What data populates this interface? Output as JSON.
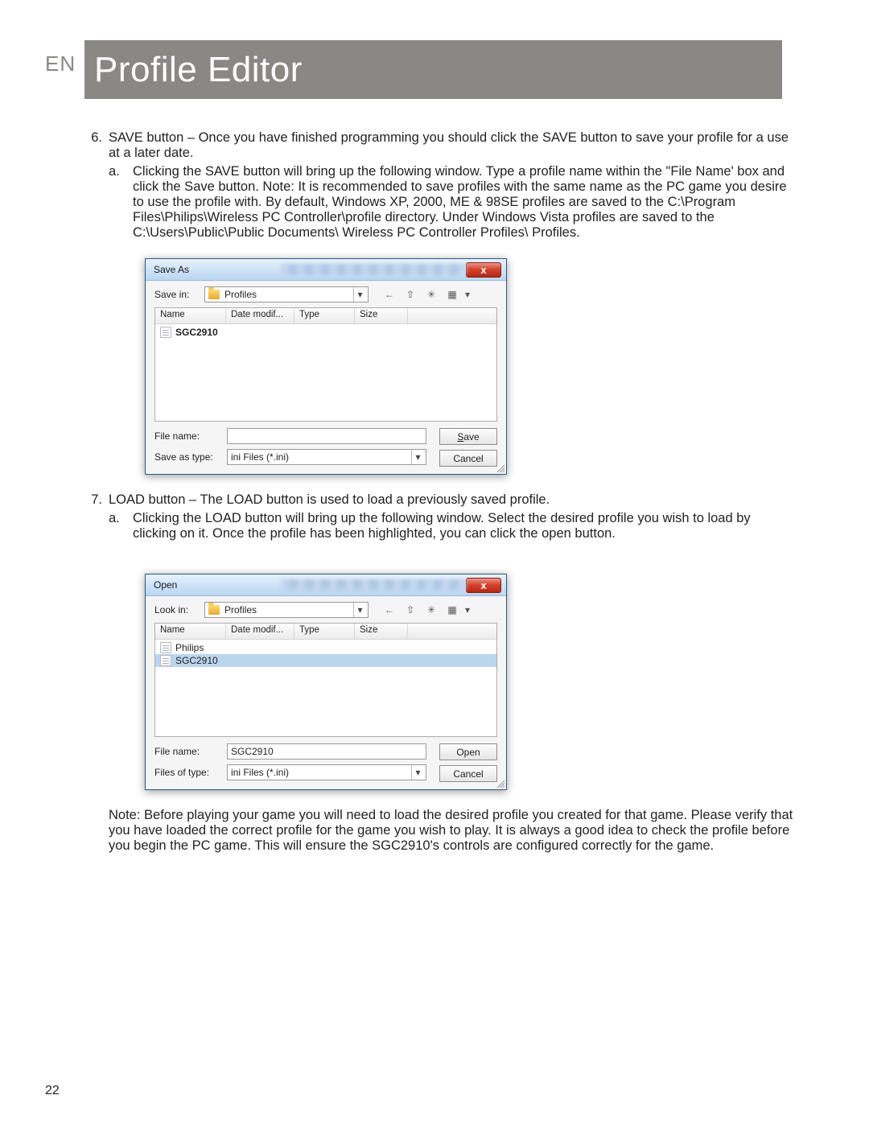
{
  "header": {
    "lang": "EN",
    "title": "Profile Editor"
  },
  "step6": {
    "num": "6.",
    "text": "SAVE button – Once you have finished programming you should click the SAVE button to save your profile for a use at a later date.",
    "sub_a_label": "a.",
    "sub_a_text": "Clicking the SAVE button will bring up the following window. Type a profile name within the \"File Name' box and click the Save button. Note: It is recommended to save profiles with the same name as the PC game you desire to use the profile with. By default, Windows XP, 2000, ME & 98SE profiles are saved to the C:\\Program Files\\Philips\\Wireless PC Controller\\profile directory. Under Windows Vista profiles are saved to the C:\\Users\\Public\\Public Documents\\ Wireless PC Controller Profiles\\ Profiles."
  },
  "saveDialog": {
    "title": "Save As",
    "close": "x",
    "saveInLabel": "Save in:",
    "folder": "Profiles",
    "columns": {
      "name": "Name",
      "date": "Date modif...",
      "type": "Type",
      "size": "Size"
    },
    "files": [
      {
        "name": "SGC2910",
        "selected": false
      }
    ],
    "fileNameLabel": "File name:",
    "fileNameValue": "",
    "saveTypeLabel": "Save as type:",
    "saveTypeValue": "ini Files (*.ini)",
    "btnSave": "Save",
    "btnCancel": "Cancel"
  },
  "step7": {
    "num": "7.",
    "text": "LOAD button – The LOAD button is used to load a previously saved profile.",
    "sub_a_label": "a.",
    "sub_a_text": "Clicking the LOAD button will bring up the following window. Select the desired profile you wish to load by clicking on it. Once the profile has been highlighted, you can click the open button."
  },
  "openDialog": {
    "title": "Open",
    "close": "x",
    "lookInLabel": "Look in:",
    "folder": "Profiles",
    "columns": {
      "name": "Name",
      "date": "Date modif...",
      "type": "Type",
      "size": "Size"
    },
    "files": [
      {
        "name": "Philips",
        "selected": false
      },
      {
        "name": "SGC2910",
        "selected": true
      }
    ],
    "fileNameLabel": "File name:",
    "fileNameValue": "SGC2910",
    "filesTypeLabel": "Files of type:",
    "filesTypeValue": "ini Files (*.ini)",
    "btnOpen": "Open",
    "btnCancel": "Cancel"
  },
  "note": "Note: Before playing your game you will need to load the desired profile you created for that game. Please verify that you have loaded the correct profile for the game you wish to play. It is always a good idea to check the profile before you begin the PC game. This will ensure the SGC2910's controls are configured correctly for the game.",
  "pageNumber": "22",
  "iconsAlt": {
    "back": "←",
    "up": "⇧",
    "new": "✳",
    "views": "▦",
    "dropdown": "▾"
  }
}
